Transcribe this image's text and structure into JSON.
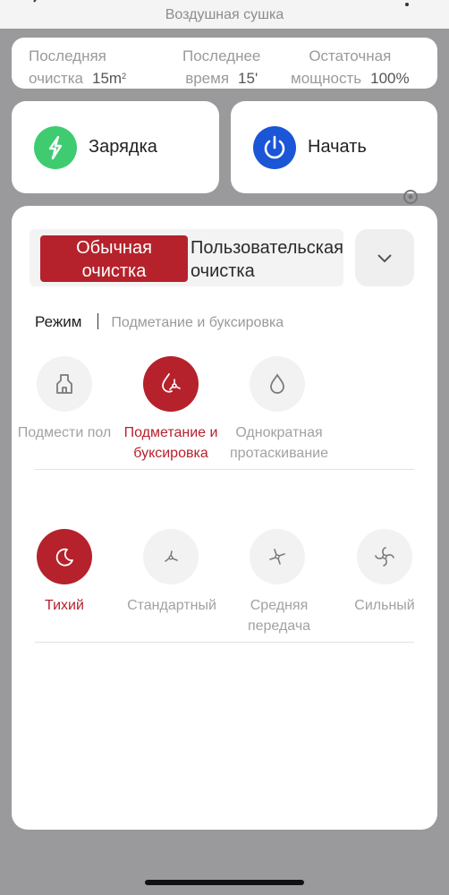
{
  "header": {
    "title": "Воздушная сушка"
  },
  "stats": {
    "last_cleaning": {
      "label": "Последняя",
      "label2": "очистка",
      "value": "15m",
      "unit_sup": "2"
    },
    "last_time": {
      "label": "Последнее",
      "label2": "время",
      "value": "15'"
    },
    "remaining_power": {
      "label": "Остаточная",
      "label2": "мощность",
      "value": "100%"
    }
  },
  "actions": {
    "charge": {
      "label": "Зарядка",
      "color": "#3fcb70"
    },
    "start": {
      "label": "Начать",
      "color": "#1a56d6"
    }
  },
  "tabs": {
    "normal": {
      "label_line1": "Обычная",
      "label_line2": "очистка"
    },
    "custom": {
      "label": "Пользовательская очистка"
    }
  },
  "mode": {
    "label": "Режим",
    "current": "Подметание и буксировка"
  },
  "mode_options": [
    {
      "line1": "Подмести пол",
      "line2": "",
      "icon": "broom-icon",
      "active": false
    },
    {
      "line1": "Подметание и",
      "line2": "буксировка",
      "icon": "sweep-mop-icon",
      "active": true
    },
    {
      "line1": "Однократная",
      "line2": "протаскивание",
      "icon": "water-drop-icon",
      "active": false
    }
  ],
  "suction_options": [
    {
      "line1": "Тихий",
      "line2": "",
      "icon": "moon-icon",
      "active": true
    },
    {
      "line1": "Стандартный",
      "line2": "",
      "icon": "fan-small-icon",
      "active": false
    },
    {
      "line1": "Средняя",
      "line2": "передача",
      "icon": "fan-medium-icon",
      "active": false
    },
    {
      "line1": "Сильный",
      "line2": "",
      "icon": "fan-strong-icon",
      "active": false
    }
  ],
  "colors": {
    "accent": "#b5222c",
    "inactive_text": "#a2a2a2"
  }
}
